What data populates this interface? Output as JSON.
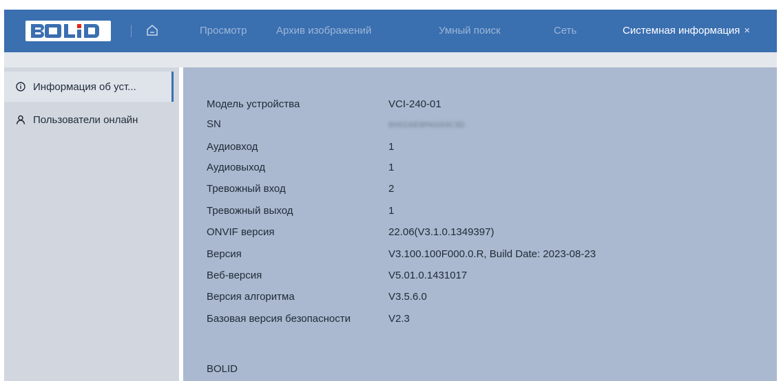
{
  "brand": {
    "logo_text": "BOLID"
  },
  "nav": {
    "tabs": [
      {
        "label": "Просмотр"
      },
      {
        "label": "Архив изображений"
      },
      {
        "label": "Умный поиск"
      },
      {
        "label": "Сеть"
      },
      {
        "label": "Системная информация"
      }
    ],
    "active_tab_close": "×"
  },
  "sidebar": {
    "items": [
      {
        "label": "Информация об уст...",
        "icon": "info-icon",
        "active": true
      },
      {
        "label": "Пользователи онлайн",
        "icon": "user-icon",
        "active": false
      }
    ]
  },
  "device_info": {
    "rows": [
      {
        "label": "Модель устройства",
        "value": "VCI-240-01"
      },
      {
        "label": "SN",
        "value": "9H02AE9PAG93C3D"
      },
      {
        "label": "Аудиовход",
        "value": "1"
      },
      {
        "label": "Аудиовыход",
        "value": "1"
      },
      {
        "label": "Тревожный вход",
        "value": "2"
      },
      {
        "label": "Тревожный выход",
        "value": "1"
      },
      {
        "label": "ONVIF версия",
        "value": "22.06(V3.1.0.1349397)"
      },
      {
        "label": "Версия",
        "value": "V3.100.100F000.0.R, Build Date: 2023-08-23"
      },
      {
        "label": "Веб-версия",
        "value": "V5.01.0.1431017"
      },
      {
        "label": "Версия алгоритма",
        "value": "V3.5.6.0"
      },
      {
        "label": "Базовая версия безопасности",
        "value": "V2.3"
      }
    ],
    "vendor": "BOLID"
  },
  "colors": {
    "topbar": "#3a6fb0",
    "sidebar": "#d2d7df",
    "content": "#aab9cf",
    "accent": "#3a6fb0"
  }
}
